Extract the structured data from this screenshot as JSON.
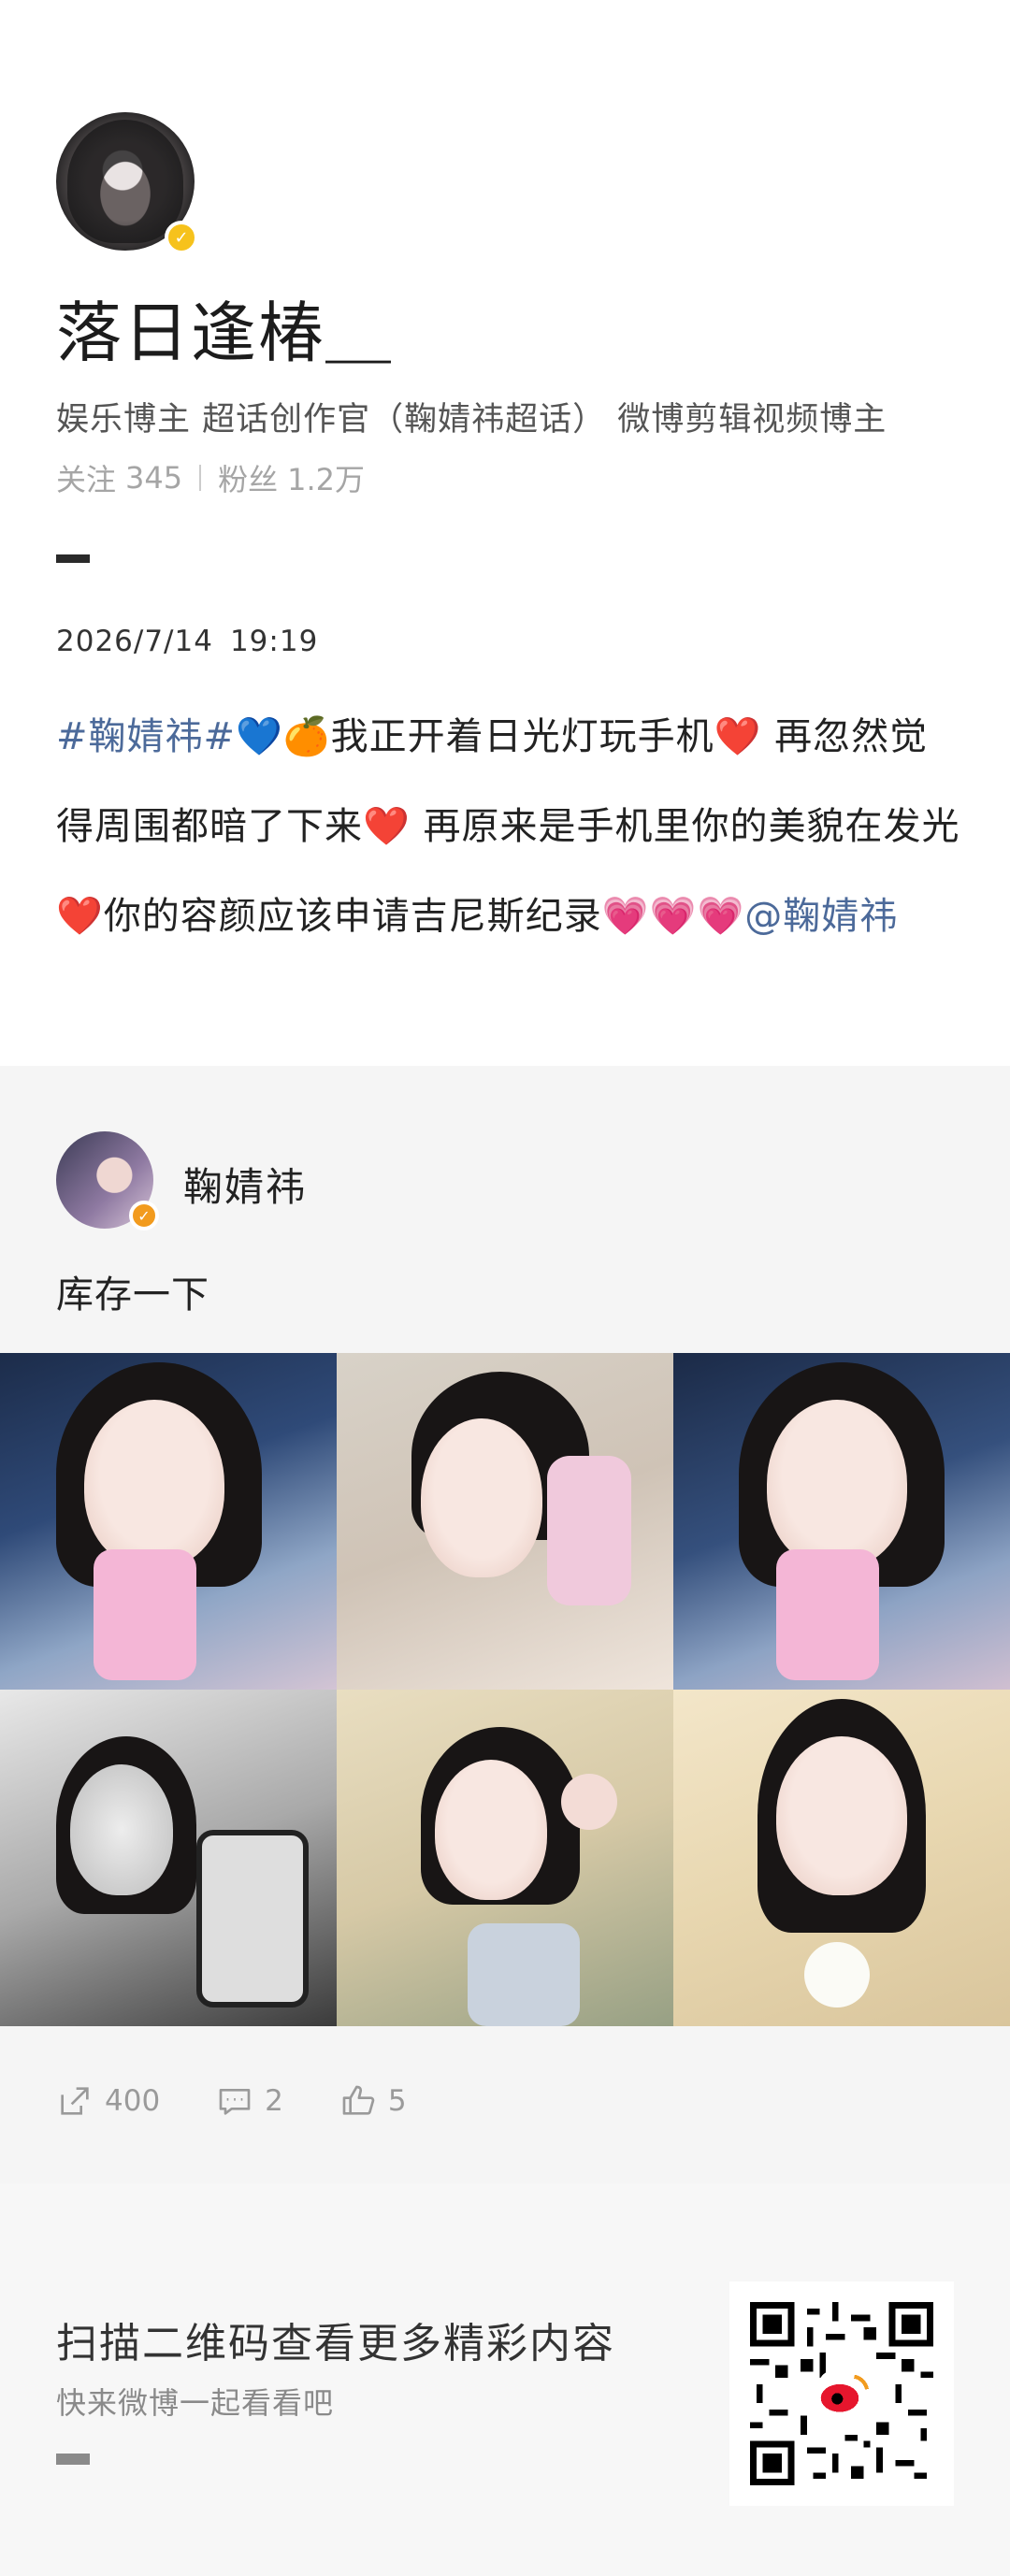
{
  "profile": {
    "username": "落日逢椿＿",
    "bio": "娱乐博主  超话创作官（鞠婧祎超话）  微博剪辑视频博主",
    "follow_label": "关注",
    "follow_count": "345",
    "fans_label": "粉丝",
    "fans_count": "1.2万",
    "verified_icon": "v-badge-icon"
  },
  "post": {
    "date": "2026/7/14",
    "time": "19:19",
    "hashtag": "#鞠婧祎#",
    "emoji1": "💙",
    "emoji2": "🍊",
    "seg1": "我正开着日光灯玩手机",
    "heart": "❤️",
    "seg2": " 再忽然觉得周围都暗了下来",
    "seg3": " 再原来是手机里你的美貌在发光",
    "seg4": "你的容颜应该申请吉尼斯纪录",
    "pink": "💗",
    "mention": "@鞠婧祎"
  },
  "card": {
    "name": "鞠婧祎",
    "text": "库存一下",
    "photos": [
      "photo-1",
      "photo-2",
      "photo-3",
      "photo-4",
      "photo-5",
      "photo-6"
    ],
    "reposts": "400",
    "comments": "2",
    "likes": "5"
  },
  "footer": {
    "title": "扫描二维码查看更多精彩内容",
    "subtitle": "快来微博一起看看吧"
  },
  "watermark": "微博",
  "colors": {
    "link": "#4c6a9a",
    "badge": "#f6c21c",
    "background_card": "#f5f5f5"
  }
}
